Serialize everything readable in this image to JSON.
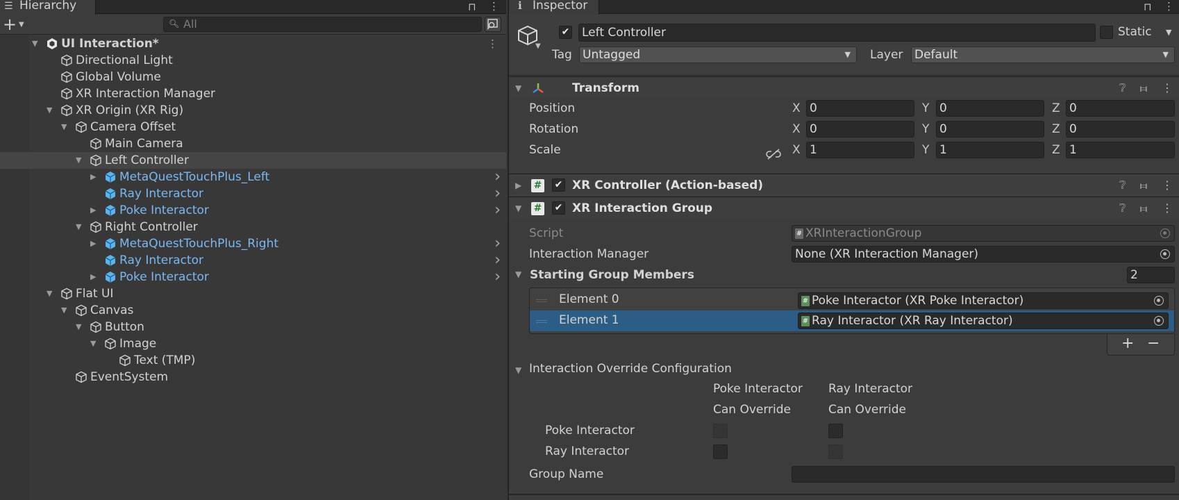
{
  "hierarchy": {
    "tab_title": "Hierarchy",
    "search_placeholder": "All",
    "items": [
      {
        "label": "UI Interaction*",
        "depth": 0,
        "expanded": true,
        "kind": "scene"
      },
      {
        "label": "Directional Light",
        "depth": 1,
        "kind": "object"
      },
      {
        "label": "Global Volume",
        "depth": 1,
        "kind": "object"
      },
      {
        "label": "XR Interaction Manager",
        "depth": 1,
        "kind": "object"
      },
      {
        "label": "XR Origin (XR Rig)",
        "depth": 1,
        "expanded": true,
        "kind": "object"
      },
      {
        "label": "Camera Offset",
        "depth": 2,
        "expanded": true,
        "kind": "object"
      },
      {
        "label": "Main Camera",
        "depth": 3,
        "kind": "object"
      },
      {
        "label": "Left Controller",
        "depth": 3,
        "expanded": true,
        "kind": "object",
        "selected": true
      },
      {
        "label": "MetaQuestTouchPlus_Left",
        "depth": 4,
        "collapsed": true,
        "kind": "prefab",
        "chevron": true
      },
      {
        "label": "Ray Interactor",
        "depth": 4,
        "kind": "prefab",
        "chevron": true
      },
      {
        "label": "Poke Interactor",
        "depth": 4,
        "collapsed": true,
        "kind": "prefab",
        "chevron": true
      },
      {
        "label": "Right Controller",
        "depth": 3,
        "expanded": true,
        "kind": "object"
      },
      {
        "label": "MetaQuestTouchPlus_Right",
        "depth": 4,
        "collapsed": true,
        "kind": "prefab",
        "chevron": true
      },
      {
        "label": "Ray Interactor",
        "depth": 4,
        "kind": "prefab",
        "chevron": true
      },
      {
        "label": "Poke Interactor",
        "depth": 4,
        "collapsed": true,
        "kind": "prefab",
        "chevron": true
      },
      {
        "label": "Flat UI",
        "depth": 1,
        "expanded": true,
        "kind": "object"
      },
      {
        "label": "Canvas",
        "depth": 2,
        "expanded": true,
        "kind": "object"
      },
      {
        "label": "Button",
        "depth": 3,
        "expanded": true,
        "kind": "object"
      },
      {
        "label": "Image",
        "depth": 4,
        "expanded": true,
        "kind": "object"
      },
      {
        "label": "Text (TMP)",
        "depth": 5,
        "kind": "object"
      },
      {
        "label": "EventSystem",
        "depth": 2,
        "kind": "object"
      }
    ]
  },
  "inspector": {
    "tab_title": "Inspector",
    "object_name": "Left Controller",
    "static_label": "Static",
    "tag_label": "Tag",
    "tag_value": "Untagged",
    "layer_label": "Layer",
    "layer_value": "Default",
    "transform": {
      "title": "Transform",
      "rows": [
        {
          "label": "Position",
          "x": "0",
          "y": "0",
          "z": "0"
        },
        {
          "label": "Rotation",
          "x": "0",
          "y": "0",
          "z": "0"
        },
        {
          "label": "Scale",
          "x": "1",
          "y": "1",
          "z": "1"
        }
      ],
      "axis_x": "X",
      "axis_y": "Y",
      "axis_z": "Z"
    },
    "xr_controller": {
      "title": "XR Controller (Action-based)"
    },
    "xr_group": {
      "title": "XR Interaction Group",
      "script_label": "Script",
      "script_value": "XRInteractionGroup",
      "manager_label": "Interaction Manager",
      "manager_value": "None (XR Interaction Manager)",
      "members_label": "Starting Group Members",
      "members_count": "2",
      "elements": [
        {
          "label": "Element 0",
          "value": "Poke Interactor (XR Poke Interactor)"
        },
        {
          "label": "Element 1",
          "value": "Ray Interactor (XR Ray Interactor)"
        }
      ],
      "add_label": "+",
      "remove_label": "−",
      "override_label": "Interaction Override Configuration",
      "col1_line1": "Poke Interactor",
      "col1_line2": "Can Override",
      "col2_line1": "Ray Interactor",
      "col2_line2": "Can Override",
      "row1_label": "Poke Interactor",
      "row2_label": "Ray Interactor",
      "group_name_label": "Group Name",
      "group_name_value": ""
    }
  }
}
